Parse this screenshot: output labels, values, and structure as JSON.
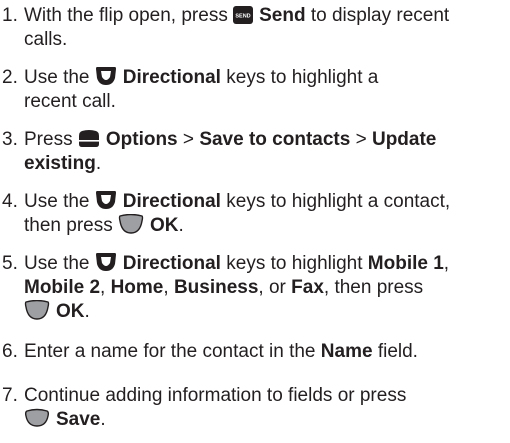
{
  "steps": [
    {
      "number": "1.",
      "parts": {
        "a": "With the flip open, press",
        "send_icon_text": "SEND",
        "b": "Send",
        "c": "to display recent",
        "d": "calls."
      }
    },
    {
      "number": "2.",
      "parts": {
        "a": "Use the",
        "b": "Directional",
        "c": "keys to highlight a",
        "d": "recent call."
      }
    },
    {
      "number": "3.",
      "parts": {
        "a": "Press",
        "b": "Options",
        "c": ">",
        "d": "Save to contacts",
        "e": ">",
        "f": "Update",
        "g": "existing",
        "h": "."
      }
    },
    {
      "number": "4.",
      "parts": {
        "a": "Use the",
        "b": "Directional",
        "c": "keys to highlight a contact,",
        "d": "then press",
        "e": "OK",
        "f": "."
      }
    },
    {
      "number": "5.",
      "parts": {
        "a": "Use the",
        "b": "Directional",
        "c": "keys to highlight",
        "d": "Mobile 1",
        "e": ",",
        "f": "Mobile 2",
        "g": ",",
        "h": "Home",
        "i": ",",
        "j": "Business",
        "k": ", or",
        "l": "Fax",
        "m": ", then press",
        "n": "OK",
        "o": "."
      }
    },
    {
      "number": "6.",
      "parts": {
        "a": "Enter a name for the contact in the",
        "b": "Name",
        "c": "field."
      }
    },
    {
      "number": "7.",
      "parts": {
        "a": "Continue adding information to fields or press",
        "b": "Save",
        "c": "."
      }
    }
  ],
  "colors": {
    "text": "#231f20",
    "key_dark": "#231f20",
    "key_gray": "#9d9fa2"
  },
  "icons": {
    "send": "send-key-icon",
    "directional": "directional-key-icon",
    "softkey": "softkey-icon",
    "ok": "ok-key-icon"
  }
}
